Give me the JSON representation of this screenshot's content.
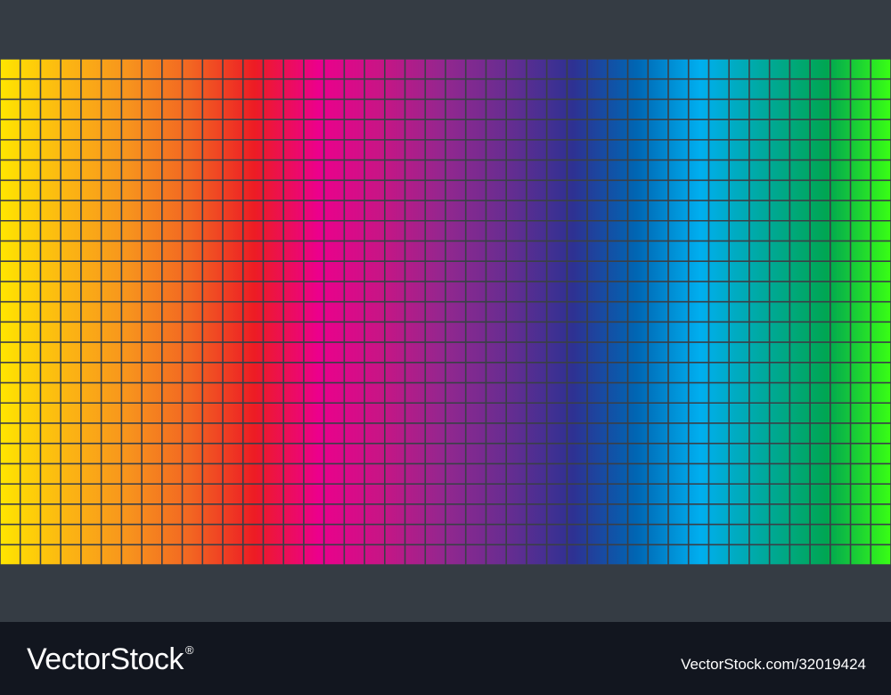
{
  "image": {
    "background_color": "#353c44",
    "footer_color": "#12161f",
    "grid": {
      "columns": 44,
      "rows": 25,
      "line_color": "#3a3f47",
      "spectrum": [
        "#ffe500",
        "#fcb712",
        "#f7941d",
        "#f26522",
        "#ed1c24",
        "#ec008c",
        "#c71585",
        "#92278f",
        "#662d91",
        "#2e3192",
        "#0066b3",
        "#00aeef",
        "#00a99d",
        "#00a651",
        "#39ff14"
      ]
    }
  },
  "watermark": {
    "logo_text": "VectorStock",
    "logo_mark": "®",
    "caption": "VectorStock.com/32019424"
  }
}
